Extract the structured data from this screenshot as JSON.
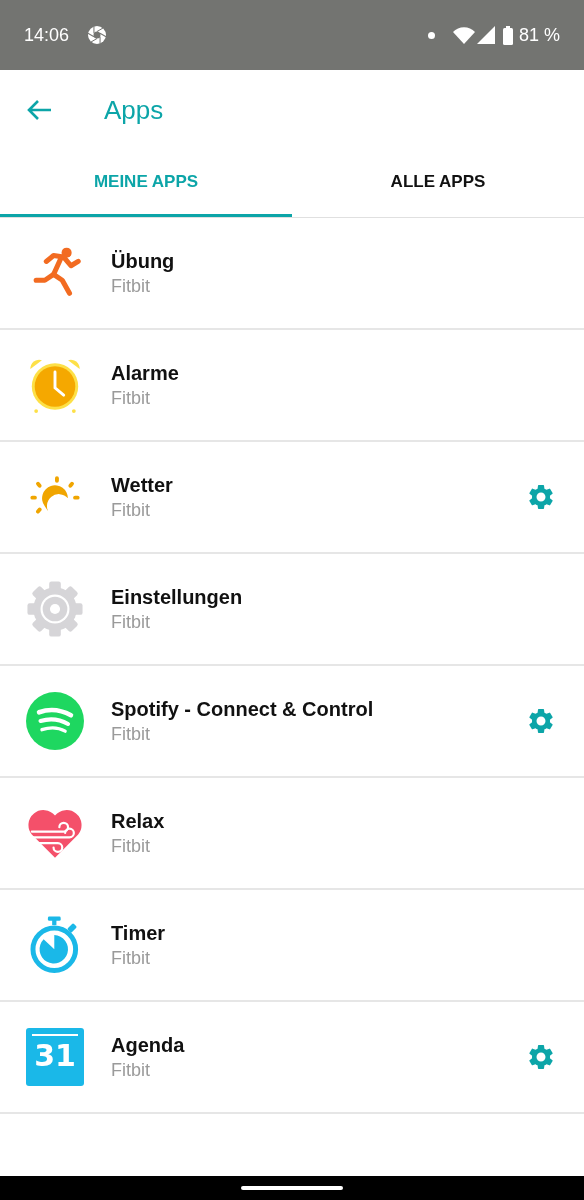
{
  "status_bar": {
    "time": "14:06",
    "battery": "81 %"
  },
  "header": {
    "title": "Apps"
  },
  "tabs": [
    {
      "label": "MEINE APPS",
      "selected": true
    },
    {
      "label": "ALLE APPS",
      "selected": false
    }
  ],
  "apps": [
    {
      "name": "Übung",
      "developer": "Fitbit",
      "settings": false
    },
    {
      "name": "Alarme",
      "developer": "Fitbit",
      "settings": false
    },
    {
      "name": "Wetter",
      "developer": "Fitbit",
      "settings": true
    },
    {
      "name": "Einstellungen",
      "developer": "Fitbit",
      "settings": false
    },
    {
      "name": "Spotify - Connect & Control",
      "developer": "Fitbit",
      "settings": true
    },
    {
      "name": "Relax",
      "developer": "Fitbit",
      "settings": false
    },
    {
      "name": "Timer",
      "developer": "Fitbit",
      "settings": false
    },
    {
      "name": "Agenda",
      "developer": "Fitbit",
      "settings": true,
      "icon_text": "31"
    }
  ]
}
